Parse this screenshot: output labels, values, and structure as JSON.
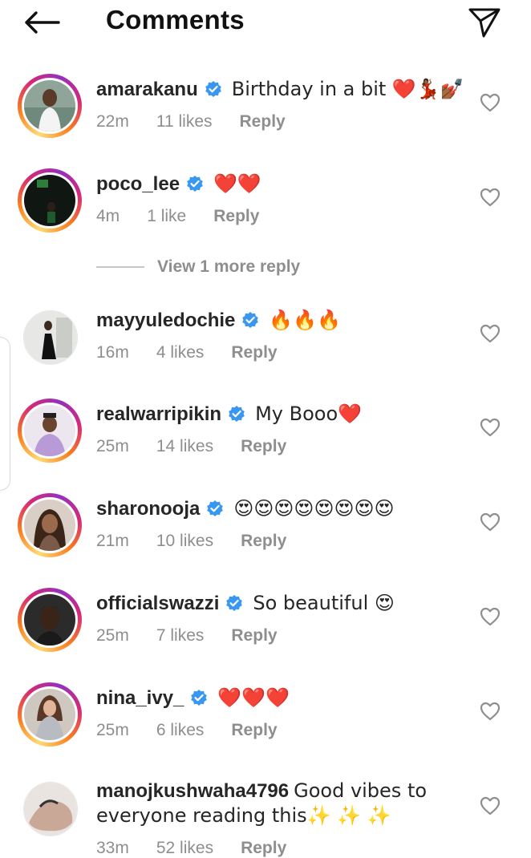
{
  "header": {
    "title": "Comments"
  },
  "icons": {
    "back": "arrow-left-icon",
    "share": "paper-plane-icon",
    "like": "heart-outline-icon",
    "verified": "verified-badge-icon"
  },
  "colors": {
    "verified": "#3897f0",
    "meta": "#8e8e8e",
    "heart_red": "#e0152b"
  },
  "view_more_label": "View 1 more reply",
  "comments": [
    {
      "username": "amarakanu",
      "verified": true,
      "text": "Birthday in a bit ❤️💃🏾💅🏾",
      "time": "22m",
      "likes": "11 likes",
      "reply": "Reply"
    },
    {
      "username": "poco_lee",
      "verified": true,
      "text": "❤️❤️",
      "time": "4m",
      "likes": "1 like",
      "reply": "Reply"
    },
    {
      "username": "mayyuledochie",
      "verified": true,
      "text": "🔥🔥🔥",
      "time": "16m",
      "likes": "4 likes",
      "reply": "Reply"
    },
    {
      "username": "realwarripikin",
      "verified": true,
      "text": "My Booo❤️",
      "time": "25m",
      "likes": "14 likes",
      "reply": "Reply"
    },
    {
      "username": "sharonooja",
      "verified": true,
      "text": "😍😍😍😍😍😍😍😍",
      "time": "21m",
      "likes": "10 likes",
      "reply": "Reply"
    },
    {
      "username": "officialswazzi",
      "verified": true,
      "text": "So beautiful 😍",
      "time": "25m",
      "likes": "7 likes",
      "reply": "Reply"
    },
    {
      "username": "nina_ivy_",
      "verified": true,
      "text": "❤️❤️❤️",
      "time": "25m",
      "likes": "6 likes",
      "reply": "Reply"
    },
    {
      "username": "manojkushwaha4796",
      "verified": false,
      "text": "Good vibes to everyone reading this✨ ✨ ✨",
      "time": "33m",
      "likes": "52 likes",
      "reply": "Reply"
    }
  ]
}
